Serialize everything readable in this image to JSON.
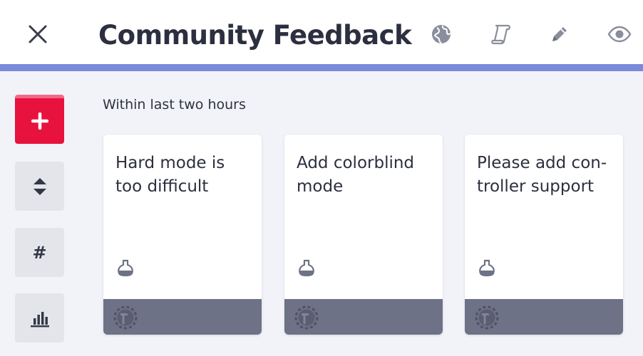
{
  "header": {
    "title": "Community Feedback",
    "icons": [
      "close-icon",
      "globe-icon",
      "scroll-icon",
      "pencil-icon",
      "eye-icon"
    ]
  },
  "sidebar": {
    "buttons": [
      {
        "icon": "plus-icon",
        "label": "+"
      },
      {
        "icon": "sort-icon",
        "label": ""
      },
      {
        "icon": "hash-icon",
        "label": "#"
      },
      {
        "icon": "bar-chart-icon",
        "label": ""
      }
    ]
  },
  "main": {
    "section_label": "Within last two hours",
    "cards": [
      {
        "title": "Hard mode is too difficult"
      },
      {
        "title": "Add colorblind mode"
      },
      {
        "title": "Please add con-troller support"
      }
    ]
  },
  "colors": {
    "accent": "#7a8ada",
    "add_button": "#e8123e",
    "card_footer": "#6d7286",
    "background": "#f1f3f8"
  }
}
